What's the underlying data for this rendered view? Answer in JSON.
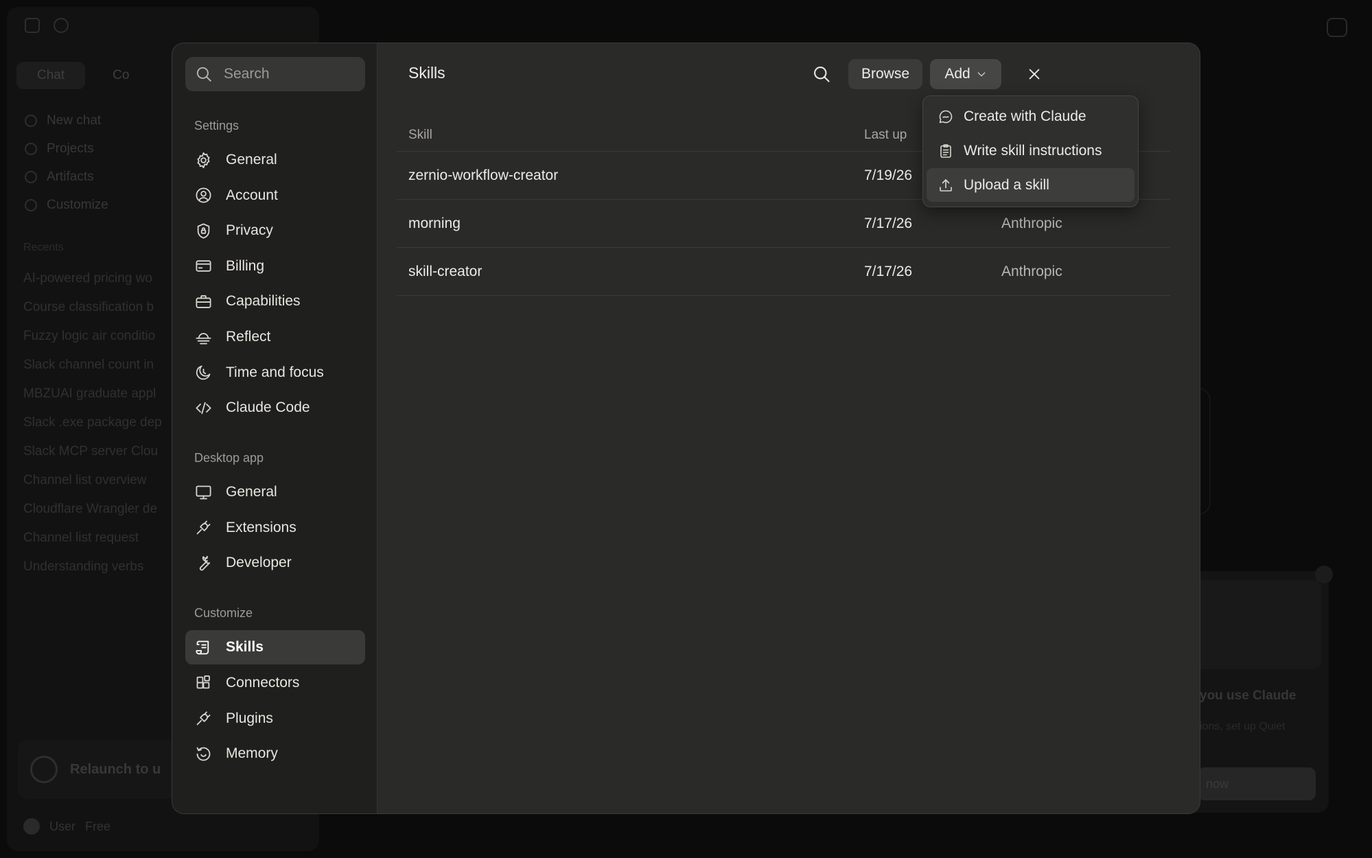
{
  "background": {
    "tabs": [
      "Chat",
      "Co"
    ],
    "nav": [
      "New chat",
      "Projects",
      "Artifacts",
      "Customize"
    ],
    "recents_label": "Recents",
    "recents": [
      "AI-powered pricing wo",
      "Course classification b",
      "Fuzzy logic air conditio",
      "Slack channel count in",
      "MBZUAI graduate appl",
      "Slack .exe package dep",
      "Slack MCP server Clou",
      "Channel list overview",
      "Cloudflare Wrangler de",
      "Channel list request",
      "Understanding verbs"
    ],
    "relaunch_text": "Relaunch to u",
    "user_name": "User",
    "user_plan": "Free",
    "card_title": "you use Claude",
    "card_sub": "ions, set up Quiet",
    "card_button": "now"
  },
  "settings": {
    "search_placeholder": "Search",
    "sections": [
      {
        "label": "Settings",
        "items": [
          {
            "label": "General",
            "icon": "gear-icon"
          },
          {
            "label": "Account",
            "icon": "user-circle-icon"
          },
          {
            "label": "Privacy",
            "icon": "shield-lock-icon"
          },
          {
            "label": "Billing",
            "icon": "credit-card-icon"
          },
          {
            "label": "Capabilities",
            "icon": "briefcase-icon"
          },
          {
            "label": "Reflect",
            "icon": "sunrise-icon"
          },
          {
            "label": "Time and focus",
            "icon": "moon-clock-icon"
          },
          {
            "label": "Claude Code",
            "icon": "code-icon"
          }
        ]
      },
      {
        "label": "Desktop app",
        "items": [
          {
            "label": "General",
            "icon": "monitor-icon"
          },
          {
            "label": "Extensions",
            "icon": "plug-icon"
          },
          {
            "label": "Developer",
            "icon": "wrench-icon"
          }
        ]
      },
      {
        "label": "Customize",
        "items": [
          {
            "label": "Skills",
            "icon": "scroll-icon",
            "active": true
          },
          {
            "label": "Connectors",
            "icon": "connectors-icon"
          },
          {
            "label": "Plugins",
            "icon": "plug-icon"
          },
          {
            "label": "Memory",
            "icon": "history-icon"
          }
        ]
      }
    ]
  },
  "main": {
    "title": "Skills",
    "browse_label": "Browse",
    "add_label": "Add",
    "columns": [
      "Skill",
      "Last up",
      ""
    ],
    "rows": [
      {
        "skill": "zernio-workflow-creator",
        "updated": "7/19/26",
        "author": ""
      },
      {
        "skill": "morning",
        "updated": "7/17/26",
        "author": "Anthropic"
      },
      {
        "skill": "skill-creator",
        "updated": "7/17/26",
        "author": "Anthropic"
      }
    ]
  },
  "add_menu": {
    "items": [
      {
        "label": "Create with Claude",
        "icon": "chat-bubble-icon"
      },
      {
        "label": "Write skill instructions",
        "icon": "clipboard-icon"
      },
      {
        "label": "Upload a skill",
        "icon": "upload-icon",
        "hovered": true
      }
    ]
  }
}
